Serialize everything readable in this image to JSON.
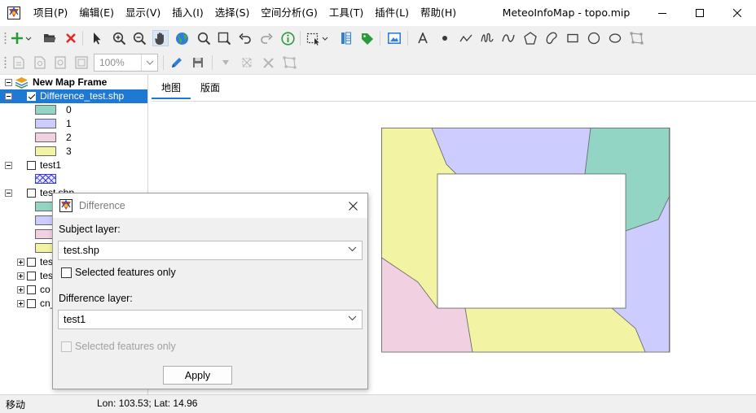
{
  "app": {
    "window_title": "MeteoInfoMap - topo.mip"
  },
  "menu": [
    "项目(P)",
    "编辑(E)",
    "显示(V)",
    "插入(I)",
    "选择(S)",
    "空间分析(G)",
    "工具(T)",
    "插件(L)",
    "帮助(H)"
  ],
  "toolbar2": {
    "zoom_value": "100%"
  },
  "tree": {
    "frame_label": "New Map Frame",
    "layers": [
      {
        "label": "Difference_test.shp",
        "legend": [
          "0",
          "1",
          "2",
          "3"
        ]
      },
      {
        "label": "test1"
      },
      {
        "label": "test.shp"
      },
      {
        "label": "tes"
      },
      {
        "label": "tes"
      },
      {
        "label": "co"
      },
      {
        "label": "cn_"
      }
    ]
  },
  "tabs": [
    "地图",
    "版面"
  ],
  "colors": {
    "class0": "#93d5c4",
    "class1": "#ccccff",
    "class2": "#f0d0e1",
    "class3": "#f3f3a4",
    "selection": "#1f78d1"
  },
  "status": {
    "mode": "移动",
    "coords": "Lon: 103.53; Lat: 14.96"
  },
  "dialog": {
    "title": "Difference",
    "subject_label": "Subject layer:",
    "subject_value": "test.shp",
    "subject_selected_only": "Selected features only",
    "difference_label": "Difference layer:",
    "difference_value": "test1",
    "difference_selected_only": "Selected features only",
    "apply": "Apply"
  }
}
